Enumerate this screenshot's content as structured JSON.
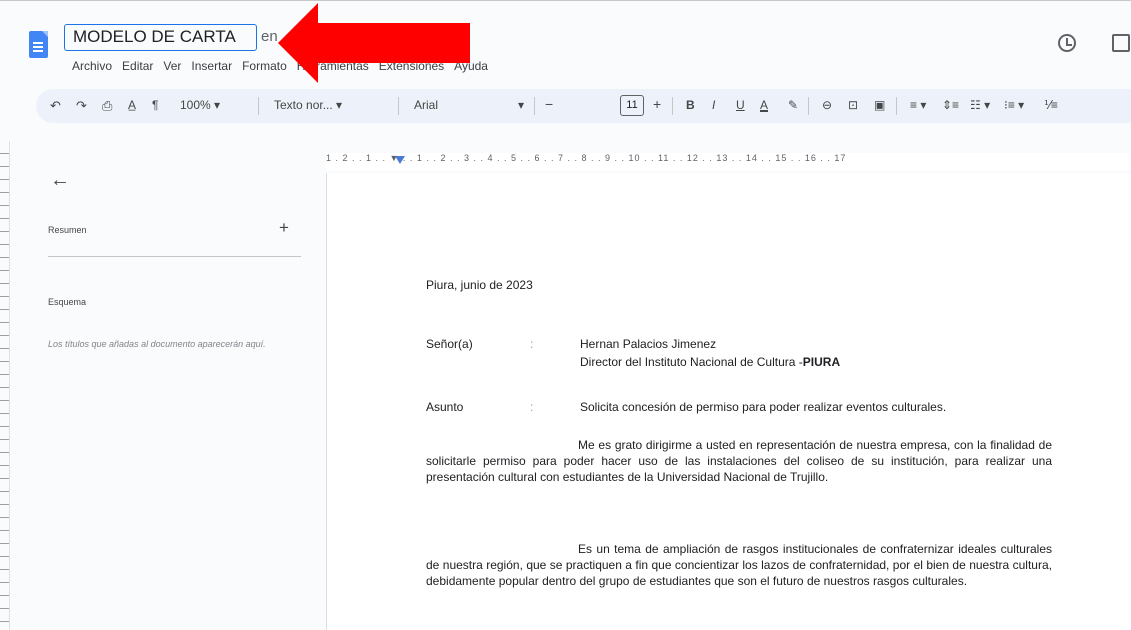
{
  "titlebar": {
    "document_title": "MODELO DE CARTA",
    "title_rest": "en"
  },
  "menu": {
    "items": [
      "Archivo",
      "Editar",
      "Ver",
      "Insertar",
      "Formato",
      "Herramientas",
      "Extensiones",
      "Ayuda"
    ]
  },
  "toolbar": {
    "zoom": "100%",
    "style": "Texto nor...",
    "font": "Arial",
    "font_size": "11",
    "bold": "B",
    "italic": "I",
    "underline": "U",
    "text_color": "A"
  },
  "ruler": {
    "labels": "1 . 2 . . 1 . . ▼ . . 1 . . 2 . . 3 . . 4 . . 5 . . 6 . . 7 . . 8 . . 9 . . 10 . . 11 . . 12 . . 13 . . 14 . . 15 . . 16 . . 17"
  },
  "outline": {
    "summary_label": "Resumen",
    "outline_label": "Esquema",
    "hint": "Los títulos que añadas al documento aparecerán aquí."
  },
  "letter": {
    "place_date": "Piura, junio de 2023",
    "to_label": "Señor(a)",
    "colon": ":",
    "recipient_name": "Hernan Palacios Jimenez",
    "recipient_title": "Director del Instituto Nacional de Cultura -",
    "recipient_city": "PIURA",
    "subject_label": "Asunto",
    "subject_text": "Solicita concesión de permiso para poder realizar eventos culturales.",
    "paragraph1": "Me es grato dirigirme a usted en representación de nuestra empresa, con la finalidad de solicitarle permiso para poder hacer uso de las instalaciones del coliseo de su institución, para realizar una presentación cultural con estudiantes de la Universidad Nacional de Trujillo.",
    "paragraph2": "Es un tema de ampliación de rasgos institucionales de confraternizar ideales culturales de nuestra región, que se practiquen a fin que concientizar los lazos de confraternidad, por el bien de nuestra cultura, debidamente popular dentro del grupo de estudiantes que son el futuro de nuestros rasgos culturales."
  },
  "colors": {
    "accent": "#1a73e8",
    "arrow": "#ff0000",
    "doc_icon": "#4285f4"
  }
}
